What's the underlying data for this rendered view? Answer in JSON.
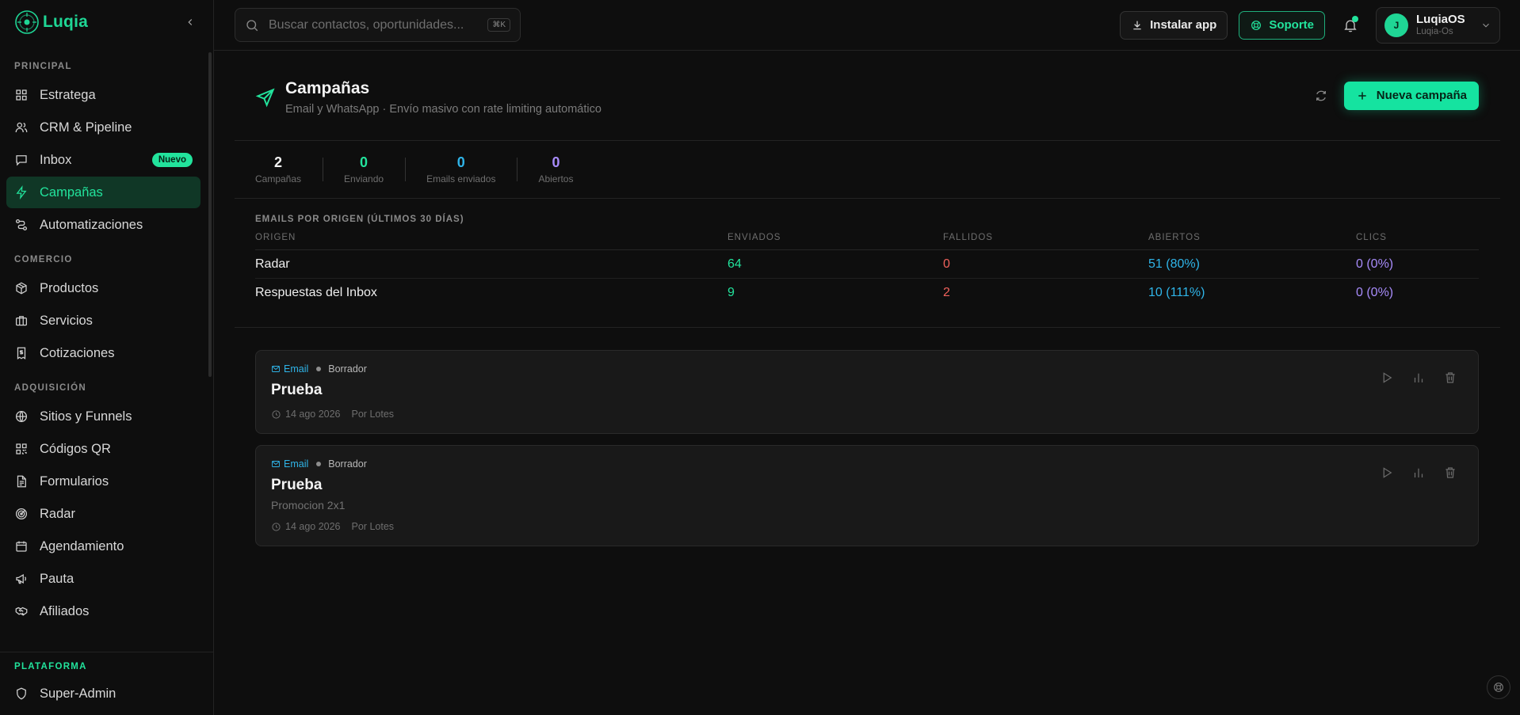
{
  "brand": {
    "name": "Luqia"
  },
  "sidebar": {
    "sections": [
      {
        "label": "PRINCIPAL",
        "items": [
          {
            "label": "Estratega",
            "icon": "dashboard-icon"
          },
          {
            "label": "CRM & Pipeline",
            "icon": "users-icon"
          },
          {
            "label": "Inbox",
            "icon": "message-icon",
            "badge": "Nuevo"
          },
          {
            "label": "Campañas",
            "icon": "zap-icon",
            "active": true
          },
          {
            "label": "Automatizaciones",
            "icon": "workflow-icon"
          }
        ]
      },
      {
        "label": "COMERCIO",
        "items": [
          {
            "label": "Productos",
            "icon": "package-icon"
          },
          {
            "label": "Servicios",
            "icon": "briefcase-icon"
          },
          {
            "label": "Cotizaciones",
            "icon": "receipt-icon"
          }
        ]
      },
      {
        "label": "ADQUISICIÓN",
        "items": [
          {
            "label": "Sitios y Funnels",
            "icon": "globe-icon"
          },
          {
            "label": "Códigos QR",
            "icon": "qr-icon"
          },
          {
            "label": "Formularios",
            "icon": "file-text-icon"
          },
          {
            "label": "Radar",
            "icon": "radar-icon"
          },
          {
            "label": "Agendamiento",
            "icon": "calendar-icon"
          },
          {
            "label": "Pauta",
            "icon": "megaphone-icon"
          },
          {
            "label": "Afiliados",
            "icon": "handshake-icon"
          }
        ]
      }
    ],
    "footer": {
      "label": "PLATAFORMA",
      "item": "Super-Admin"
    }
  },
  "topbar": {
    "search_placeholder": "Buscar contactos, oportunidades...",
    "search_shortcut": "⌘K",
    "install_label": "Instalar app",
    "support_label": "Soporte",
    "user": {
      "initial": "J",
      "name": "LuqiaOS",
      "org": "Luqia-Os"
    }
  },
  "page": {
    "title": "Campañas",
    "subtitle": "Email y WhatsApp · Envío masivo con rate limiting automático",
    "new_button": "Nueva campaña"
  },
  "stats": [
    {
      "value": "2",
      "label": "Campañas",
      "color": "#f2f2f2"
    },
    {
      "value": "0",
      "label": "Enviando",
      "color": "#22e39c"
    },
    {
      "value": "0",
      "label": "Emails enviados",
      "color": "#2fb4e8"
    },
    {
      "value": "0",
      "label": "Abiertos",
      "color": "#a78bfa"
    }
  ],
  "origin_table": {
    "title": "EMAILS POR ORIGEN (ÚLTIMOS 30 DÍAS)",
    "headers": [
      "ORIGEN",
      "ENVIADOS",
      "FALLIDOS",
      "ABIERTOS",
      "CLICS"
    ],
    "rows": [
      {
        "origin": "Radar",
        "sent": "64",
        "failed": "0",
        "opened": "51 (80%)",
        "clicks": "0 (0%)"
      },
      {
        "origin": "Respuestas del Inbox",
        "sent": "9",
        "failed": "2",
        "opened": "10 (111%)",
        "clicks": "0 (0%)"
      }
    ],
    "colors": {
      "sent": "#22e39c",
      "failed": "#f0625c",
      "opened": "#2fb4e8",
      "clicks": "#a78bfa"
    }
  },
  "campaigns": [
    {
      "channel": "Email",
      "status": "Borrador",
      "title": "Prueba",
      "description": "",
      "date": "14 ago 2026",
      "mode": "Por Lotes"
    },
    {
      "channel": "Email",
      "status": "Borrador",
      "title": "Prueba",
      "description": "Promocion 2x1",
      "date": "14 ago 2026",
      "mode": "Por Lotes"
    }
  ]
}
